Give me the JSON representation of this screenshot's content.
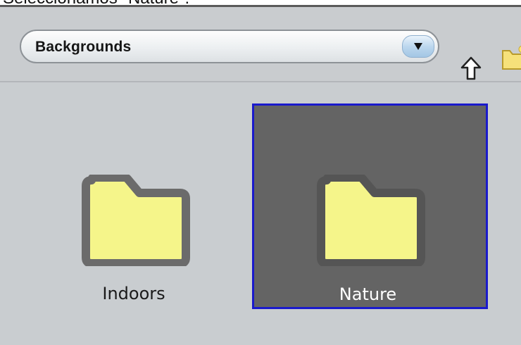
{
  "caption": "Seleccionamos \"Nature\":",
  "toolbar": {
    "location_label": "Backgrounds",
    "dropdown_icon": "triangle-down-icon",
    "up_icon": "up-arrow-icon",
    "new_folder_icon": "new-folder-icon"
  },
  "items": [
    {
      "label": "Indoors",
      "icon": "folder-icon",
      "selected": false
    },
    {
      "label": "Nature",
      "icon": "folder-icon",
      "selected": true
    }
  ],
  "colors": {
    "folder_fill": "#f5f58a",
    "folder_outline": "#6b6b6b",
    "selection_bg": "#646464",
    "selection_border": "#1a1acc",
    "panel_bg": "#c9cdd0"
  }
}
